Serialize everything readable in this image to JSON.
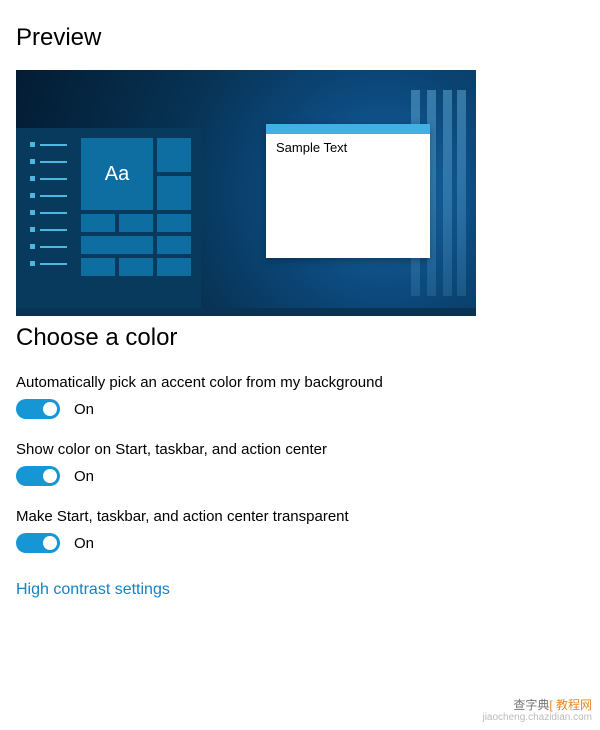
{
  "headings": {
    "preview": "Preview",
    "choose_color": "Choose a color"
  },
  "preview": {
    "tile_label": "Aa",
    "sample_text": "Sample Text"
  },
  "settings": {
    "auto_accent": {
      "label": "Automatically pick an accent color from my background",
      "state": "On"
    },
    "start_color": {
      "label": "Show color on Start, taskbar, and action center",
      "state": "On"
    },
    "transparent": {
      "label": "Make Start, taskbar, and action center transparent",
      "state": "On"
    }
  },
  "links": {
    "high_contrast": "High contrast settings"
  },
  "watermark": {
    "line1_a": "查字典",
    "line1_b": "[ 教程网",
    "line2": "jiaocheng.chazidian.com"
  },
  "colors": {
    "accent": "#1696d4",
    "link": "#1183c8"
  }
}
